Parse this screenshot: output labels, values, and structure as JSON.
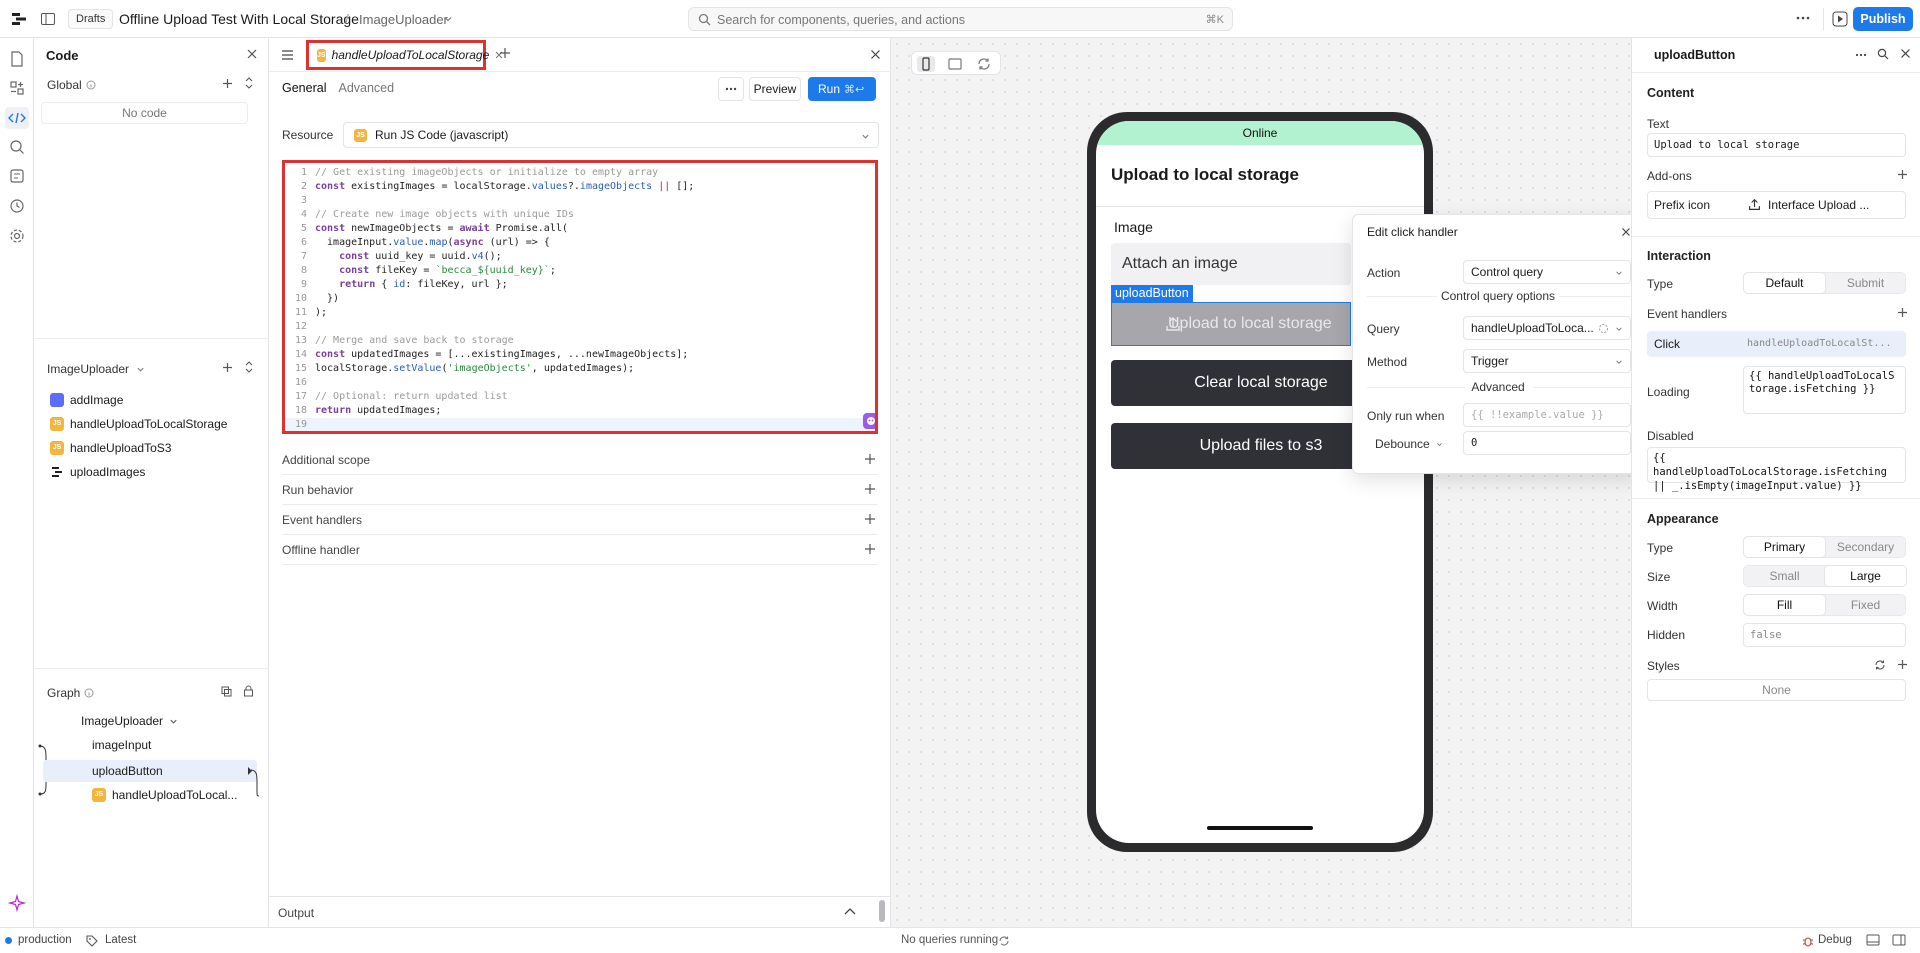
{
  "topbar": {
    "drafts": "Drafts",
    "app_title": "Offline Upload Test With Local Storage",
    "separator": "/",
    "page": "ImageUploader",
    "search_placeholder": "Search for components, queries, and actions",
    "search_shortcut": "⌘K",
    "publish": "Publish"
  },
  "code_panel": {
    "title": "Code",
    "global_label": "Global",
    "no_code": "No code",
    "page_section": "ImageUploader",
    "queries": [
      {
        "name": "addImage",
        "icon": "database-icon"
      },
      {
        "name": "handleUploadToLocalStorage",
        "icon": "js-icon"
      },
      {
        "name": "handleUploadToS3",
        "icon": "js-icon"
      },
      {
        "name": "uploadImages",
        "icon": "workflow-icon"
      }
    ],
    "graph_label": "Graph",
    "graph": {
      "root": "ImageUploader",
      "items": [
        "imageInput",
        "uploadButton",
        "handleUploadToLocal..."
      ]
    }
  },
  "editor": {
    "tab_label": "handleUploadToLocalStorage",
    "tab_general": "General",
    "tab_advanced": "Advanced",
    "preview": "Preview",
    "run": "Run",
    "run_shortcut": "⌘↩",
    "resource_label": "Resource",
    "resource_value": "Run JS Code (javascript)",
    "code_lines": [
      "// Get existing imageObjects or initialize to empty array",
      "const existingImages = localStorage.values?.imageObjects || [];",
      "",
      "// Create new image objects with unique IDs",
      "const newImageObjects = await Promise.all(",
      "  imageInput.value.map(async (url) => {",
      "    const uuid_key = uuid.v4();",
      "    const fileKey = `becca_${uuid_key}`;",
      "    return { id: fileKey, url };",
      "  })",
      ");",
      "",
      "// Merge and save back to storage",
      "const updatedImages = [...existingImages, ...newImageObjects];",
      "localStorage.setValue('imageObjects', updatedImages);",
      "",
      "// Optional: return updated list",
      "return updatedImages;",
      ""
    ],
    "sections": [
      "Additional scope",
      "Run behavior",
      "Event handlers",
      "Offline handler"
    ],
    "output": "Output"
  },
  "phone": {
    "status": "Online",
    "title": "Upload to local storage",
    "image_label": "Image",
    "attach": "Attach an image",
    "selected_tag": "uploadButton",
    "upload_button": "Upload to local storage",
    "clear_button": "Clear local storage",
    "s3_button": "Upload files to s3"
  },
  "click_handler": {
    "title": "Edit click handler",
    "action_label": "Action",
    "action_value": "Control query",
    "options_heading": "Control query options",
    "query_label": "Query",
    "query_value": "handleUploadToLoca...",
    "method_label": "Method",
    "method_value": "Trigger",
    "advanced_heading": "Advanced",
    "only_run_label": "Only run when",
    "only_run_placeholder": "{{ !!example.value }}",
    "debounce_label": "Debounce",
    "debounce_value": "0"
  },
  "inspector": {
    "title": "uploadButton",
    "content": "Content",
    "text_label": "Text",
    "text_value": "Upload to local storage",
    "addons_label": "Add-ons",
    "prefix_label": "Prefix icon",
    "prefix_value": "Interface Upload ...",
    "interaction": "Interaction",
    "type_label": "Type",
    "type_options": [
      "Default",
      "Submit"
    ],
    "event_handlers": "Event handlers",
    "event_name": "Click",
    "event_query": "handleUploadToLocalSt...",
    "loading_label": "Loading",
    "loading_value": "{{ handleUploadToLocalStorage.isFetching }}",
    "disabled_label": "Disabled",
    "disabled_value": "{{ handleUploadToLocalStorage.isFetching || _.isEmpty(imageInput.value) }}",
    "appearance": "Appearance",
    "app_type_label": "Type",
    "app_type_options": [
      "Primary",
      "Secondary"
    ],
    "size_label": "Size",
    "size_options": [
      "Small",
      "Large"
    ],
    "width_label": "Width",
    "width_options": [
      "Fill",
      "Fixed"
    ],
    "hidden_label": "Hidden",
    "hidden_value": "false",
    "styles_label": "Styles",
    "styles_value": "None"
  },
  "statusbar": {
    "env": "production",
    "version": "Latest",
    "queries": "No queries running",
    "debug": "Debug"
  },
  "colors": {
    "accent": "#1d7aeb",
    "highlight": "#e03131",
    "online": "#b2f2d0",
    "dark_button": "#2f3136"
  }
}
